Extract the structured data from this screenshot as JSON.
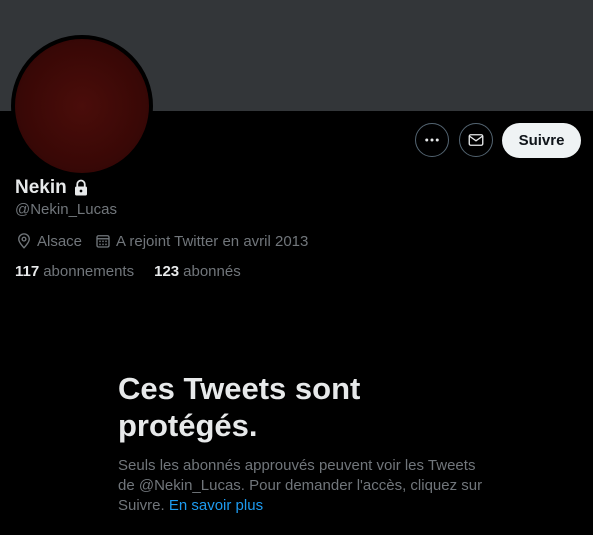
{
  "profile": {
    "name": "Nekin",
    "handle": "@Nekin_Lucas",
    "location": "Alsace",
    "joined": "A rejoint Twitter en avril 2013",
    "following_count": "117",
    "following_label": "abonnements",
    "followers_count": "123",
    "followers_label": "abonnés"
  },
  "actions": {
    "follow_label": "Suivre",
    "more_icon": "more-icon",
    "message_icon": "envelope-icon"
  },
  "protected": {
    "title": "Ces Tweets sont protégés.",
    "body": "Seuls les abonnés approuvés peuvent voir les Tweets de @Nekin_Lucas. Pour demander l'accès, cliquez sur Suivre.",
    "link": "En savoir plus"
  },
  "colors": {
    "background": "#000000",
    "banner": "#333639",
    "link": "#1d9bf0",
    "muted": "#71767b"
  }
}
